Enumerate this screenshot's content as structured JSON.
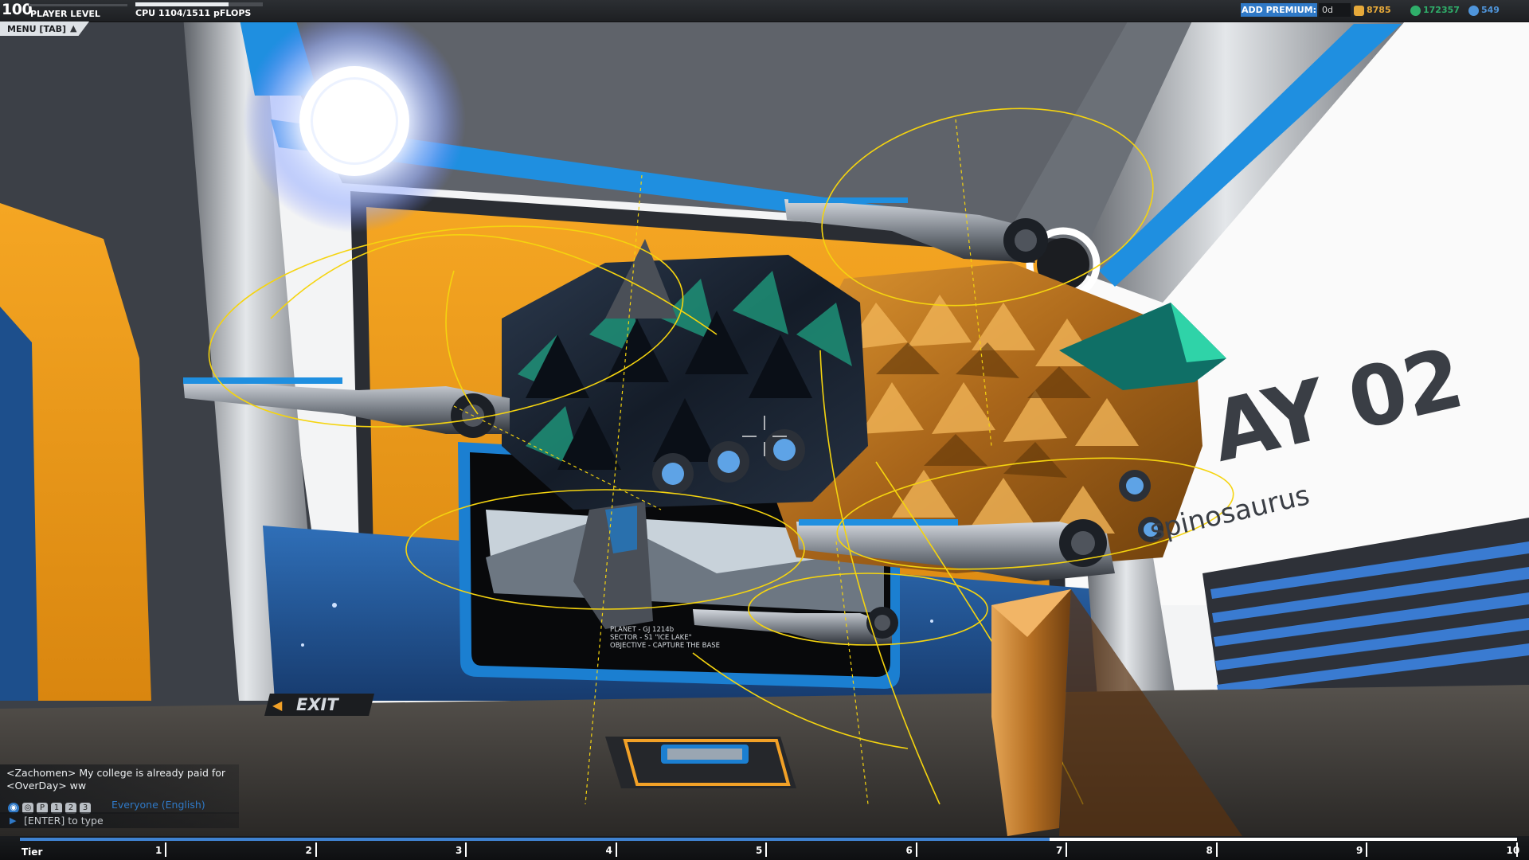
{
  "hud": {
    "player_level": "100",
    "player_level_label": "PLAYER LEVEL",
    "cpu_text": "CPU 1104/1511 pFLOPS",
    "cpu_fraction": 0.73
  },
  "currency": {
    "add_premium_label": "ADD PREMIUM:",
    "premium_value": "0d",
    "robits": "8785",
    "rp": "172357",
    "cc": "549"
  },
  "menu": {
    "label": "MENU [TAB]",
    "arrow": "▲"
  },
  "chat": {
    "messages": [
      "<Zachomen> My college is already paid for",
      "<OverDay> ww"
    ],
    "channel": "Everyone (English)",
    "input_placeholder": "[ENTER] to type",
    "icon_labels": {
      "public": "P",
      "group": "1",
      "clan": "2",
      "private": "3"
    }
  },
  "tier": {
    "label": "Tier",
    "ticks": [
      "1",
      "2",
      "3",
      "4",
      "5",
      "6",
      "7",
      "8",
      "9",
      "10"
    ],
    "progress_fraction": 0.688
  },
  "scene": {
    "bay_text": "AY 02",
    "bay_subtitle": "spinosaurus",
    "exit_label": "EXIT",
    "mission": {
      "planet": "PLANET - GJ 1214b",
      "sector": "SECTOR - S1 \"ICE LAKE\"",
      "objective": "OBJECTIVE - CAPTURE THE BASE"
    }
  },
  "colors": {
    "accent_blue": "#2f79c7",
    "accent_orange": "#f2a127",
    "gizmo_yellow": "#f5d40f",
    "hud_dark": "#1d1f22"
  }
}
